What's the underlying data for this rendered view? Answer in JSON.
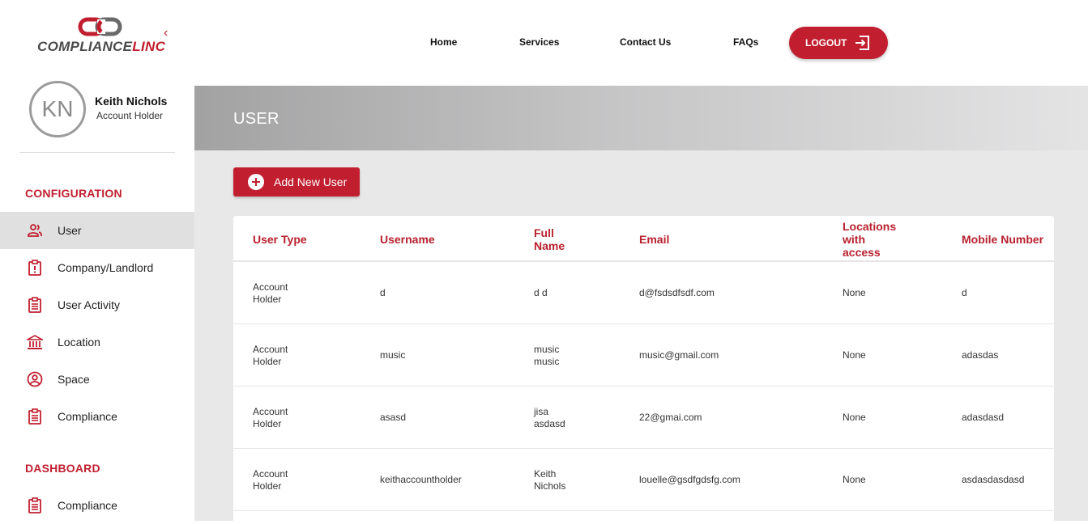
{
  "brand": {
    "logo_part1": "COMPLIANCE",
    "logo_part2": "LINC",
    "collapse_icon": "chevron-left-icon",
    "accent_color": "#c11f2f"
  },
  "profile": {
    "initials": "KN",
    "name": "Keith Nichols",
    "role": "Account Holder"
  },
  "sidebar": {
    "configuration_title": "CONFIGURATION",
    "config_items": [
      {
        "label": "User",
        "icon": "users-icon",
        "active": true
      },
      {
        "label": "Company/Landlord",
        "icon": "alert-clipboard-icon"
      },
      {
        "label": "User Activity",
        "icon": "clipboard-list-icon"
      },
      {
        "label": "Location",
        "icon": "bank-icon"
      },
      {
        "label": "Space",
        "icon": "user-circle-icon"
      },
      {
        "label": "Compliance",
        "icon": "clipboard-list-icon"
      }
    ],
    "dashboard_title": "DASHBOARD",
    "dashboard_items": [
      {
        "label": "Compliance",
        "icon": "clipboard-list-icon"
      }
    ]
  },
  "nav": {
    "home": "Home",
    "services": "Services",
    "contact": "Contact Us",
    "faqs": "FAQs",
    "logout": "LOGOUT"
  },
  "page": {
    "title": "USER",
    "add_button": "Add New User"
  },
  "table": {
    "headers": [
      "User Type",
      "Username",
      "Full Name",
      "Email",
      "Locations with access",
      "Mobile Number"
    ],
    "rows": [
      {
        "user_type": "Account Holder",
        "username": "d",
        "full_name": "d d",
        "email": "d@fsdsdfsdf.com",
        "locations": "None",
        "mobile": "d"
      },
      {
        "user_type": "Account Holder",
        "username": "music",
        "full_name": "music music",
        "email": "music@gmail.com",
        "locations": "None",
        "mobile": "adasdas"
      },
      {
        "user_type": "Account Holder",
        "username": "asasd",
        "full_name": "jisa asdasd",
        "email": "22@gmai.com",
        "locations": "None",
        "mobile": "adasdasd"
      },
      {
        "user_type": "Account Holder",
        "username": "keithaccountholder",
        "full_name": "Keith Nichols",
        "email": "louelle@gsdfgdsfg.com",
        "locations": "None",
        "mobile": "asdasdasdasd"
      }
    ]
  }
}
